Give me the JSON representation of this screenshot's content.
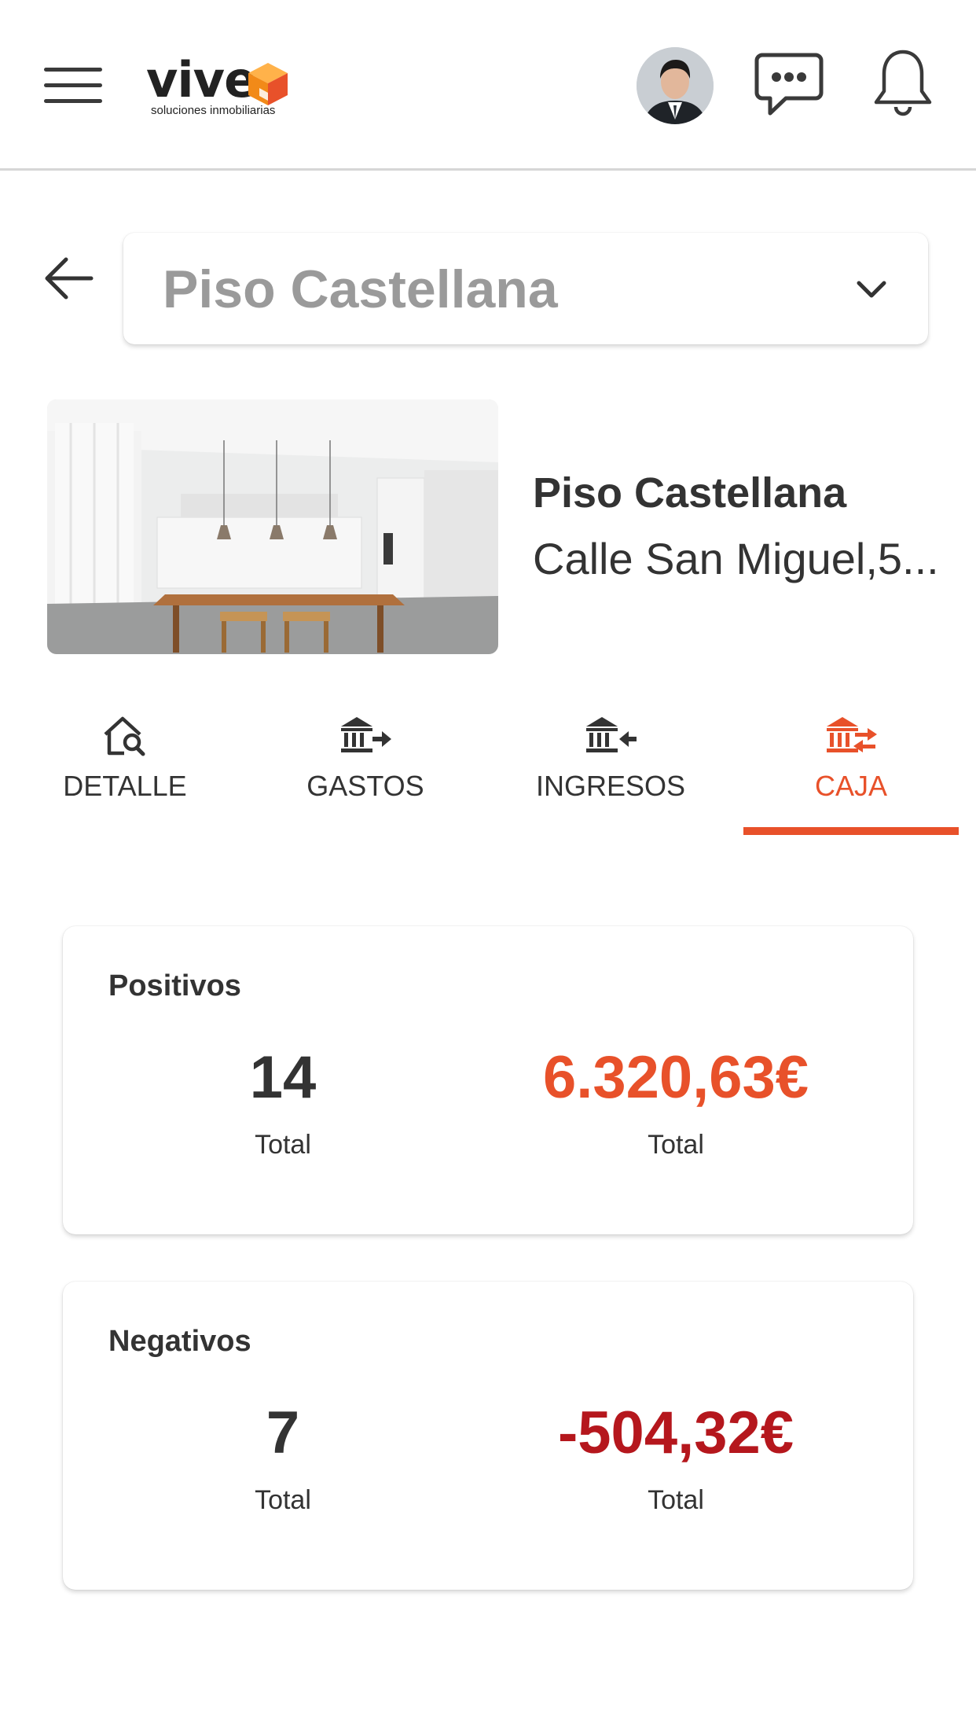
{
  "header": {
    "logo": {
      "word": "vive",
      "tagline": "soluciones inmobiliarias"
    },
    "icons": [
      "menu-icon",
      "avatar",
      "chat-icon",
      "bell-icon"
    ]
  },
  "selector": {
    "value": "Piso Castellana"
  },
  "property": {
    "name": "Piso Castellana",
    "address": "Calle San Miguel,5..."
  },
  "tabs": [
    {
      "label": "DETALLE",
      "icon": "house-search-icon",
      "active": false
    },
    {
      "label": "GASTOS",
      "icon": "bank-out-icon",
      "active": false
    },
    {
      "label": "INGRESOS",
      "icon": "bank-in-icon",
      "active": false
    },
    {
      "label": "CAJA",
      "icon": "bank-transfer-icon",
      "active": true
    }
  ],
  "summary": {
    "positive": {
      "title": "Positivos",
      "count": "14",
      "count_label": "Total",
      "amount": "6.320,63€",
      "amount_label": "Total"
    },
    "negative": {
      "title": "Negativos",
      "count": "7",
      "count_label": "Total",
      "amount": "-504,32€",
      "amount_label": "Total"
    }
  },
  "colors": {
    "accent": "#e8512a",
    "negative": "#b5171d",
    "text": "#333333",
    "placeholder": "#9a9a9a"
  }
}
